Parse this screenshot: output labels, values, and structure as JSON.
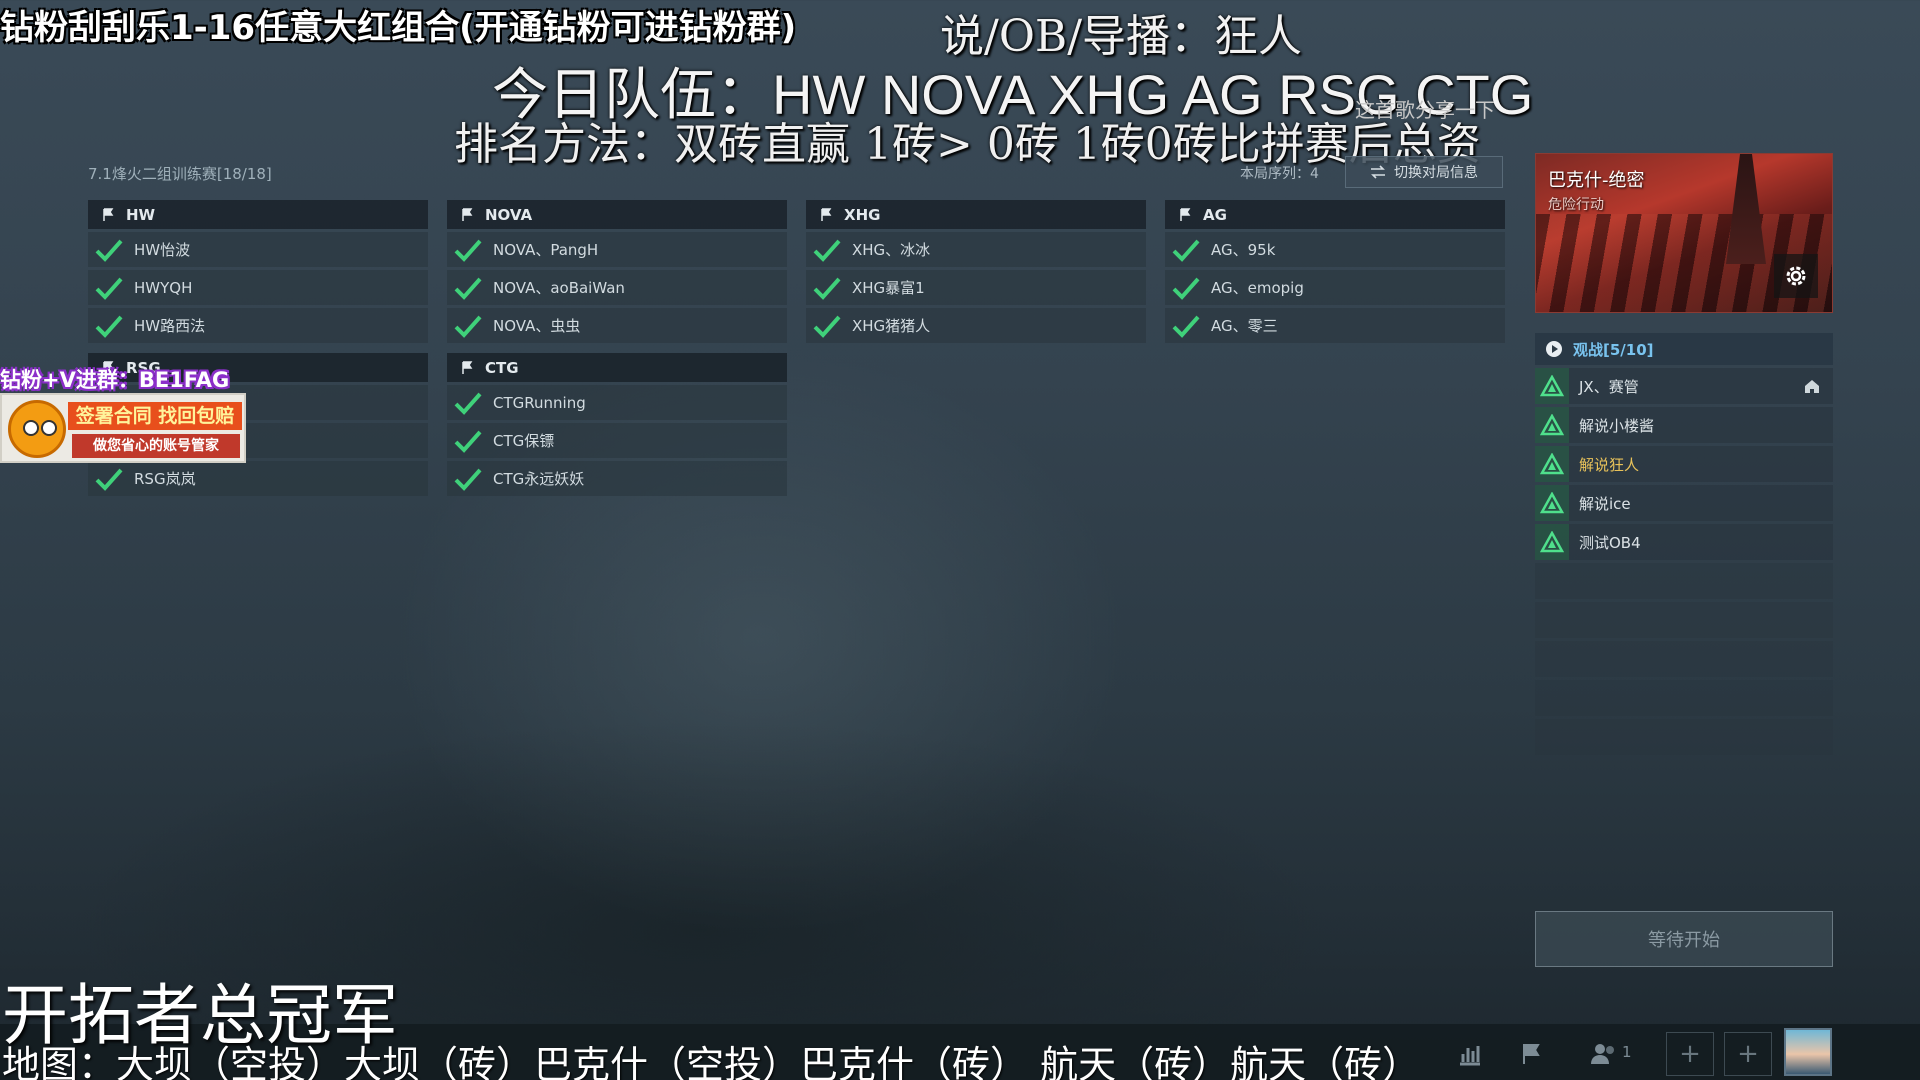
{
  "overlay": {
    "top_caption": "钻粉刮刮乐1-16任意大红组合(开通钻粉可进钻粉群)",
    "top_caption_tail": "说/OB/导播：狂人",
    "teams_line_prefix": "今日队伍：",
    "teams_line_teams": "HW NOVA XHG AG RSG CTG",
    "rank_line": "排名方法：双砖直赢 1砖> 0砖 1砖0砖比拼赛后总资",
    "share_hint": "这首歌分享一下",
    "ad_line": "钻粉+V进群：BE1FAG",
    "ad_main": "签署合同 找回包赔",
    "ad_sub": "做您省心的账号管家",
    "champion_line": "开拓者总冠军",
    "map_line": "地图：大坝（空投）大坝（砖）巴克什（空投）巴克什（砖） 航天（砖）航天（砖）"
  },
  "lobby": {
    "match_name": "7.1烽火二组训练赛[18/18]",
    "round_label": "本局序列：",
    "round_value": "4",
    "switch_button": "切换对局信息",
    "teams": [
      {
        "name": "HW",
        "players": [
          "HW怡波",
          "HWYQH",
          "HW路西法"
        ]
      },
      {
        "name": "NOVA",
        "players": [
          "NOVA、PangH",
          "NOVA、aoBaiWan",
          "NOVA、虫虫"
        ]
      },
      {
        "name": "XHG",
        "players": [
          "XHG、冰冰",
          "XHG暴富1",
          "XHG猪猪人"
        ]
      },
      {
        "name": "AG",
        "players": [
          "AG、95k",
          "AG、emopig",
          "AG、零三"
        ]
      },
      {
        "name": "RSG",
        "players": [
          "",
          "",
          "RSG岚岚"
        ]
      },
      {
        "name": "CTG",
        "players": [
          "CTGRunning",
          "CTG保镖",
          "CTG永远妖妖"
        ]
      }
    ]
  },
  "map_card": {
    "name": "巴克什-绝密",
    "mode": "危险行动"
  },
  "spectators": {
    "header": "观战[5/10]",
    "rows": [
      "JX、赛管",
      "解说小楼酱",
      "解说狂人",
      "解说ice",
      "测试OB4"
    ],
    "highlight_color": "#e8c25a"
  },
  "wait_button": "等待开始",
  "bottom_bar": {
    "players_count": "1"
  },
  "colors": {
    "check": "#3fd17a",
    "accent_blue": "#79c3ee"
  }
}
